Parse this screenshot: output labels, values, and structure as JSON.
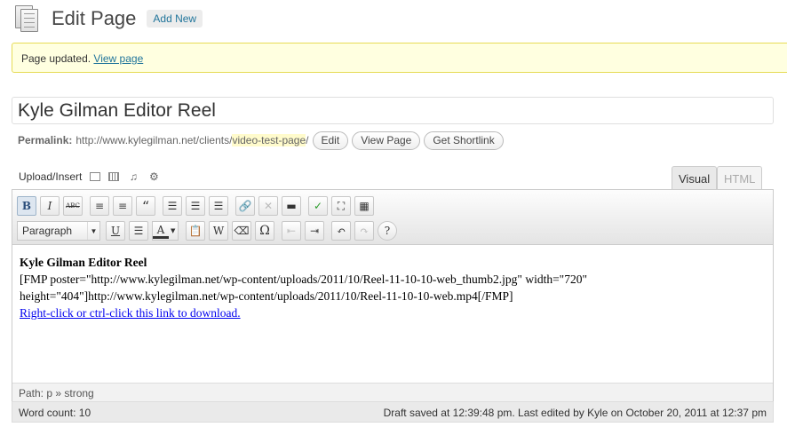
{
  "header": {
    "title": "Edit Page",
    "add_new": "Add New"
  },
  "notice": {
    "message": "Page updated.",
    "link": "View page"
  },
  "post_title": "Kyle Gilman Editor Reel",
  "permalink": {
    "label": "Permalink:",
    "base": "http://www.kylegilman.net/clients/",
    "slug": "video-test-page",
    "suffix": "/",
    "buttons": {
      "edit": "Edit",
      "view": "View Page",
      "shortlink": "Get Shortlink"
    }
  },
  "media": {
    "label": "Upload/Insert"
  },
  "tabs": {
    "visual": "Visual",
    "html": "HTML"
  },
  "toolbar": {
    "row1": {
      "bold": "B",
      "italic": "I",
      "strike": "ABC",
      "blockquote": "“"
    },
    "row2": {
      "format": "Paragraph",
      "underline": "U",
      "color": "A",
      "special": "Ω"
    }
  },
  "content": {
    "heading": "Kyle Gilman Editor Reel",
    "shortcode_line1": "[FMP poster=\"http://www.kylegilman.net/wp-content/uploads/2011/10/Reel-11-10-10-web_thumb2.jpg\" width=\"720\"",
    "shortcode_line2": "height=\"404\"]http://www.kylegilman.net/wp-content/uploads/2011/10/Reel-11-10-10-web.mp4[/FMP]",
    "download_link": "Right-click or ctrl-click this link to download."
  },
  "path": "Path: p » strong",
  "status": {
    "word_count": "Word count: 10",
    "draft_saved": "Draft saved at 12:39:48 pm. Last edited by Kyle on October 20, 2011 at 12:37 pm"
  }
}
